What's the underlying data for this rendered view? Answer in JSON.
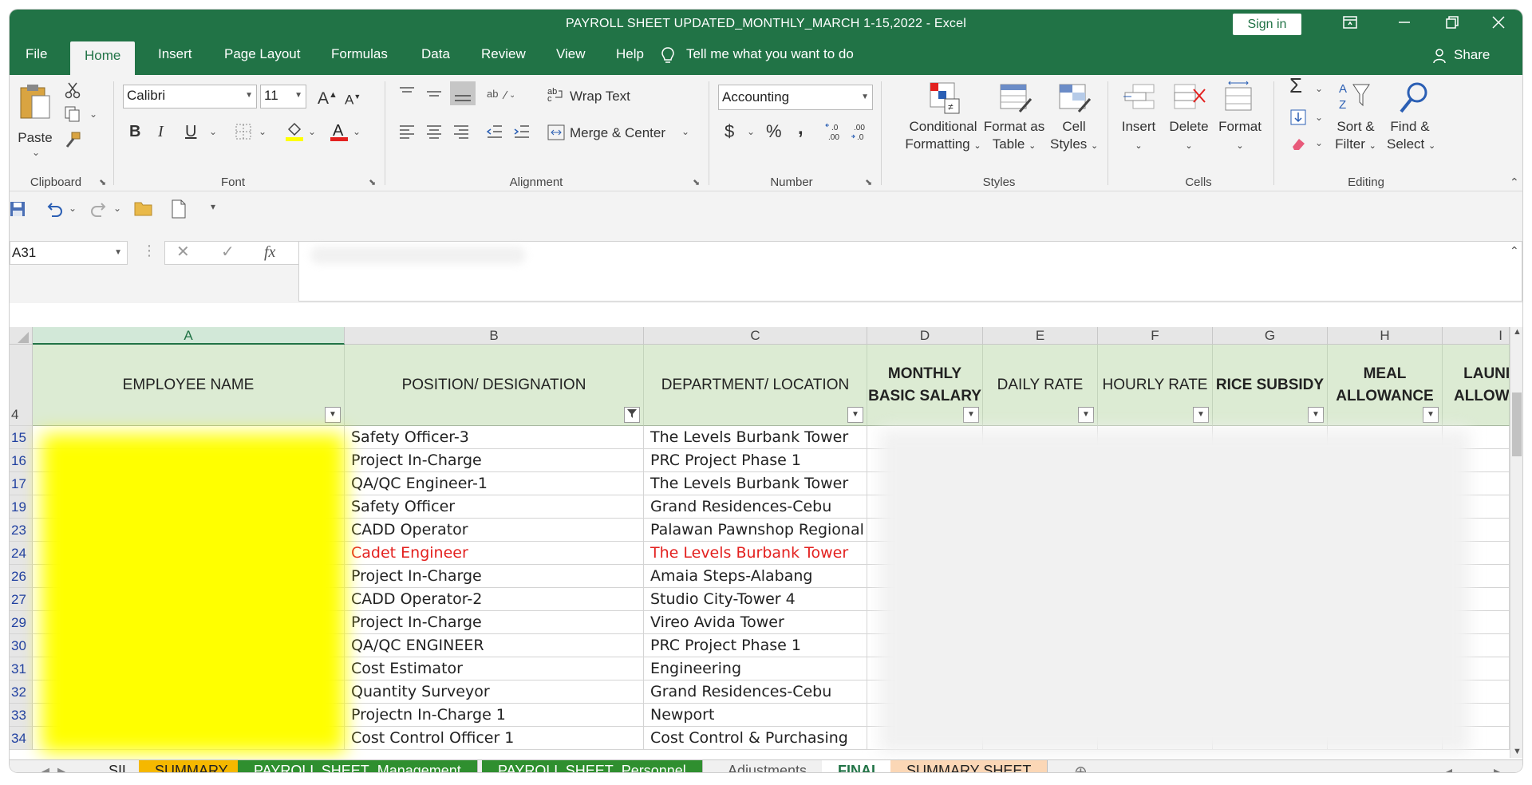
{
  "window": {
    "title": "PAYROLL SHEET UPDATED_MONTHLY_MARCH 1-15,2022  -  Excel",
    "sign_in": "Sign in",
    "controls": {
      "ribbon_display": "ribbon-display-icon",
      "minimize": "minimize-icon",
      "restore": "restore-icon",
      "close": "close-icon"
    }
  },
  "ribbon_tabs": {
    "file": "File",
    "home": "Home",
    "insert": "Insert",
    "page_layout": "Page Layout",
    "formulas": "Formulas",
    "data": "Data",
    "review": "Review",
    "view": "View",
    "help": "Help",
    "tell_me": "Tell me what you want to do",
    "share": "Share"
  },
  "ribbon": {
    "clipboard": {
      "label": "Clipboard",
      "paste": "Paste"
    },
    "font": {
      "label": "Font",
      "name": "Calibri",
      "size": "11",
      "bold": "B",
      "italic": "I",
      "underline": "U",
      "grow": "A",
      "shrink": "A"
    },
    "alignment": {
      "label": "Alignment",
      "wrap_text": "Wrap Text",
      "merge_center": "Merge & Center"
    },
    "number": {
      "label": "Number",
      "format": "Accounting",
      "currency": "$",
      "percent": "%",
      "comma": ",",
      "inc_decimal": ".00",
      "dec_decimal": ".0"
    },
    "styles": {
      "label": "Styles",
      "conditional_1": "Conditional",
      "conditional_2": "Formatting",
      "format_table_1": "Format as",
      "format_table_2": "Table",
      "cell_styles_1": "Cell",
      "cell_styles_2": "Styles"
    },
    "cells": {
      "label": "Cells",
      "insert": "Insert",
      "delete": "Delete",
      "format": "Format"
    },
    "editing": {
      "label": "Editing",
      "sort_1": "Sort &",
      "sort_2": "Filter",
      "find_1": "Find &",
      "find_2": "Select"
    }
  },
  "formula_bar": {
    "name_box": "A31",
    "fx": "fx",
    "cancel": "✕",
    "enter": "✓"
  },
  "columns": [
    {
      "letter": "A"
    },
    {
      "letter": "B"
    },
    {
      "letter": "C"
    },
    {
      "letter": "D"
    },
    {
      "letter": "E"
    },
    {
      "letter": "F"
    },
    {
      "letter": "G"
    },
    {
      "letter": "H"
    },
    {
      "letter": "I"
    }
  ],
  "header_row": {
    "row_number": "4",
    "employee_name": "EMPLOYEE NAME",
    "position": "POSITION/ DESIGNATION",
    "department": "DEPARTMENT/ LOCATION",
    "monthly_basic_1": "MONTHLY",
    "monthly_basic_2": "BASIC SALARY",
    "daily_rate": "DAILY RATE",
    "hourly_rate": "HOURLY RATE",
    "rice_subsidy": "RICE SUBSIDY",
    "meal_1": "MEAL",
    "meal_2": "ALLOWANCE",
    "laundry_1": "LAUNI",
    "laundry_2": "ALLOWA"
  },
  "rows": [
    {
      "num": "15",
      "position": "Safety Officer-3",
      "department": "The Levels Burbank Tower"
    },
    {
      "num": "16",
      "position": "Project In-Charge",
      "department": "PRC Project Phase 1"
    },
    {
      "num": "17",
      "position": "QA/QC Engineer-1",
      "department": "The Levels Burbank Tower"
    },
    {
      "num": "19",
      "position": "Safety Officer",
      "department": "Grand Residences-Cebu"
    },
    {
      "num": "23",
      "position": "CADD Operator",
      "department": "Palawan Pawnshop Regional C"
    },
    {
      "num": "24",
      "position": "Cadet Engineer",
      "department": "The Levels Burbank Tower"
    },
    {
      "num": "26",
      "position": "Project In-Charge",
      "department": "Amaia Steps-Alabang"
    },
    {
      "num": "27",
      "position": "CADD Operator-2",
      "department": "Studio City-Tower 4"
    },
    {
      "num": "29",
      "position": "Project In-Charge",
      "department": "Vireo Avida Tower"
    },
    {
      "num": "30",
      "position": "QA/QC ENGINEER",
      "department": "PRC Project Phase 1"
    },
    {
      "num": "31",
      "position": "Cost Estimator",
      "department": "Engineering"
    },
    {
      "num": "32",
      "position": "Quantity Surveyor",
      "department": "Grand Residences-Cebu"
    },
    {
      "num": "33",
      "position": "Projectn In-Charge 1",
      "department": "Newport"
    },
    {
      "num": "34",
      "position": "Cost Control Officer 1",
      "department": "Cost Control & Purchasing"
    }
  ],
  "sheet_tabs": [
    {
      "label": "SIL"
    },
    {
      "label": "SUMMARY"
    },
    {
      "label": "PAYROLL SHEET_Management"
    },
    {
      "label": "PAYROLL SHEET_Personnel"
    },
    {
      "label": "Adjustments"
    },
    {
      "label": "FINAL"
    },
    {
      "label": "SUMMARY SHEET"
    }
  ],
  "colors": {
    "excel_green": "#217346",
    "header_fill": "#dcebd3",
    "highlight_yellow": "#ffff00",
    "red_text": "#e3211f"
  }
}
